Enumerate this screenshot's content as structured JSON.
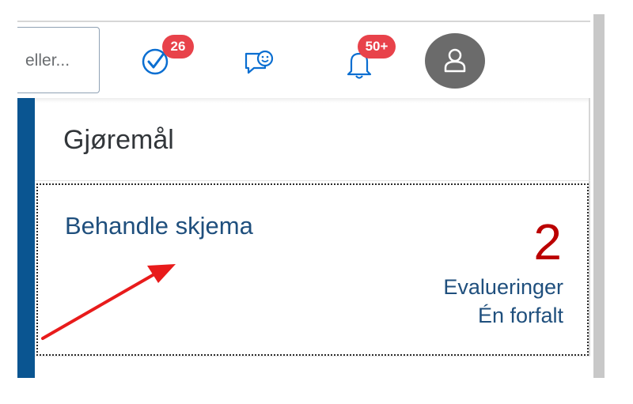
{
  "header": {
    "search_text": "eller...",
    "tasks_badge": "26",
    "notifications_badge": "50+",
    "colors": {
      "badge": "#e8424a",
      "icon": "#0a6ed1",
      "avatar": "#6b6b6b"
    },
    "icons": [
      "check-circle-icon",
      "feedback-icon",
      "bell-icon",
      "person-icon"
    ]
  },
  "section": {
    "title": "Gjøremål"
  },
  "tile": {
    "title": "Behandle skjema",
    "number": "2",
    "unit": "Evalueringer",
    "info": "Én forfalt",
    "colors": {
      "number": "#bb0000",
      "text": "#1f4f7d",
      "accent": "#0a5591"
    }
  },
  "annotation": {
    "arrow_color": "#e81b1b"
  }
}
